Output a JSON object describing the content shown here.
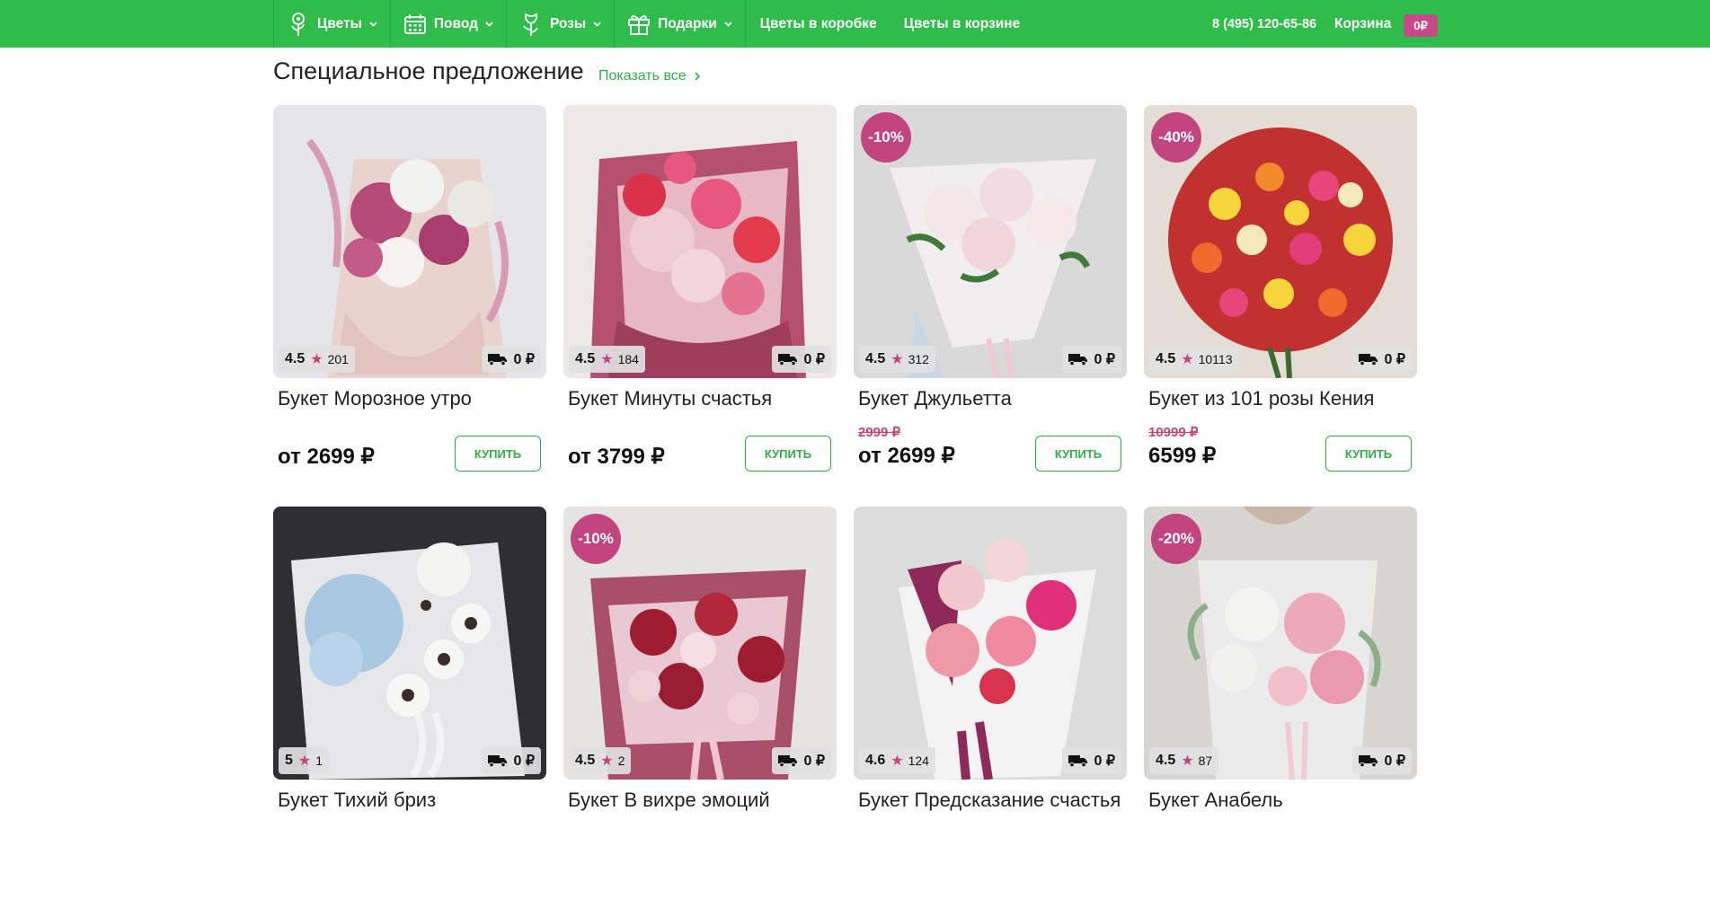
{
  "nav": {
    "menu": [
      {
        "label": "Цветы",
        "icon": "flower-icon"
      },
      {
        "label": "Повод",
        "icon": "calendar-icon"
      },
      {
        "label": "Розы",
        "icon": "rose-icon"
      },
      {
        "label": "Подарки",
        "icon": "gift-icon"
      }
    ],
    "links": [
      "Цветы в коробке",
      "Цветы в корзине"
    ],
    "phone": "8 (495) 120-65-86",
    "cart_label": "Корзина",
    "cart_total": "0₽"
  },
  "section": {
    "title": "Специальное предложение",
    "show_all": "Показать все"
  },
  "buy_label": "КУПИТЬ",
  "products": [
    {
      "name": "Букет Морозное утро",
      "rating": "4.5",
      "reviews": "201",
      "delivery": "0 ₽",
      "discount": "",
      "old_price": "",
      "price": "от 2699 ₽"
    },
    {
      "name": "Букет Минуты счастья",
      "rating": "4.5",
      "reviews": "184",
      "delivery": "0 ₽",
      "discount": "",
      "old_price": "",
      "price": "от 3799 ₽"
    },
    {
      "name": "Букет Джульетта",
      "rating": "4.5",
      "reviews": "312",
      "delivery": "0 ₽",
      "discount": "-10%",
      "old_price": "2999 ₽",
      "price": "от 2699 ₽"
    },
    {
      "name": "Букет из 101 розы Кения",
      "rating": "4.5",
      "reviews": "10113",
      "delivery": "0 ₽",
      "discount": "-40%",
      "old_price": "10999 ₽",
      "price": "6599 ₽"
    },
    {
      "name": "Букет Тихий бриз",
      "rating": "5",
      "reviews": "1",
      "delivery": "0 ₽",
      "discount": "",
      "old_price": "",
      "price": ""
    },
    {
      "name": "Букет В вихре эмоций",
      "rating": "4.5",
      "reviews": "2",
      "delivery": "0 ₽",
      "discount": "-10%",
      "old_price": "",
      "price": ""
    },
    {
      "name": "Букет Предсказание счастья",
      "rating": "4.6",
      "reviews": "124",
      "delivery": "0 ₽",
      "discount": "",
      "old_price": "",
      "price": ""
    },
    {
      "name": "Букет Анабель",
      "rating": "4.5",
      "reviews": "87",
      "delivery": "0 ₽",
      "discount": "-20%",
      "old_price": "",
      "price": ""
    }
  ],
  "colors": {
    "nav_green": "#2fbc4b",
    "accent_pink": "#c2457f",
    "buy_green": "#2fae44"
  }
}
